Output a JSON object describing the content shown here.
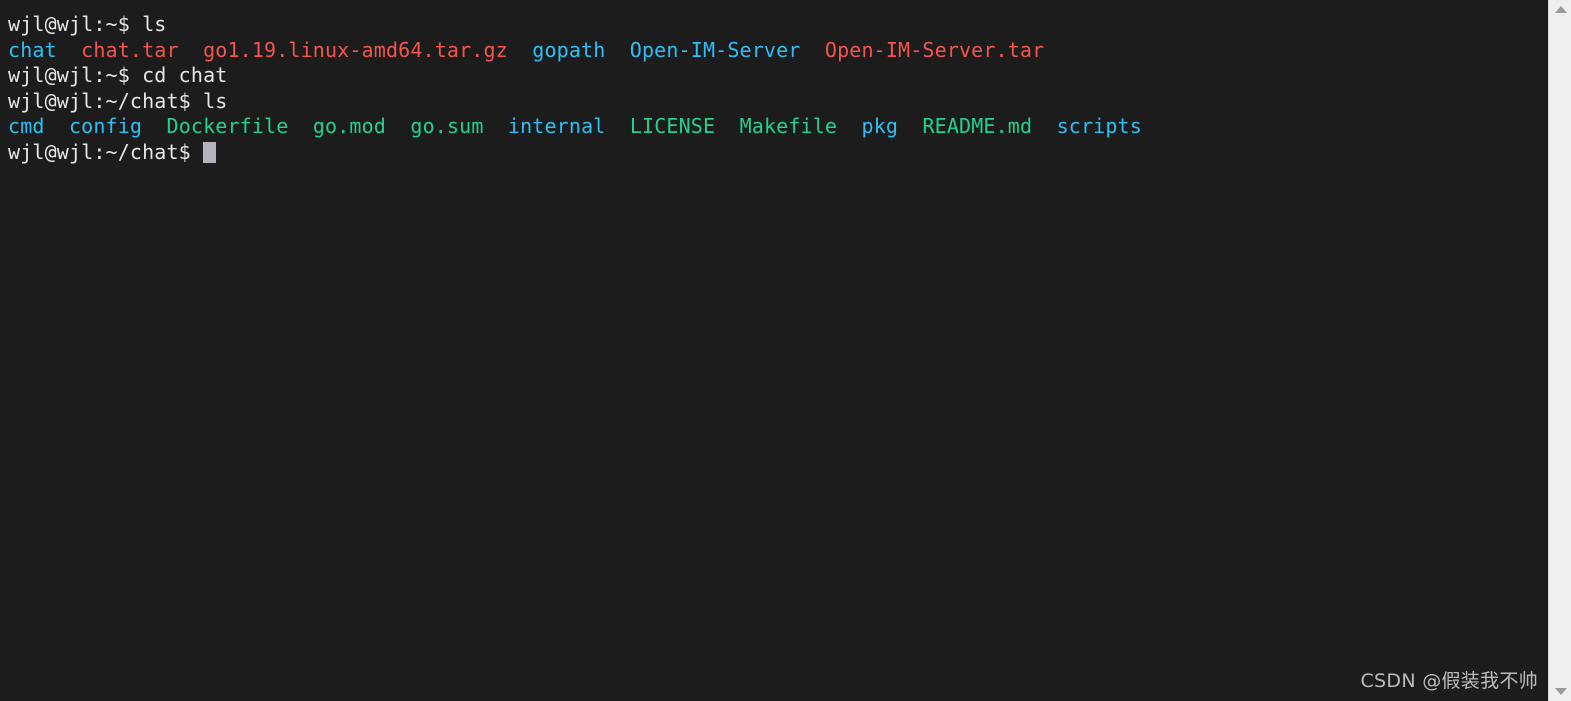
{
  "terminal": {
    "prompt_user_host_home": "wjl@wjl:~$ ",
    "prompt_user_host_chat": "wjl@wjl:~/chat$ ",
    "lines": [
      {
        "id": "line-cmd-ls-home",
        "segments": [
          {
            "text": "wjl@wjl:~$ ",
            "kind": "default"
          },
          {
            "text": "ls",
            "kind": "default"
          }
        ]
      },
      {
        "id": "line-output-ls-home",
        "segments": [
          {
            "text": "chat",
            "kind": "dir"
          },
          {
            "text": "  ",
            "kind": "default"
          },
          {
            "text": "chat.tar",
            "kind": "archive"
          },
          {
            "text": "  ",
            "kind": "default"
          },
          {
            "text": "go1.19.linux-amd64.tar.gz",
            "kind": "archive"
          },
          {
            "text": "  ",
            "kind": "default"
          },
          {
            "text": "gopath",
            "kind": "dir"
          },
          {
            "text": "  ",
            "kind": "default"
          },
          {
            "text": "Open-IM-Server",
            "kind": "dir"
          },
          {
            "text": "  ",
            "kind": "default"
          },
          {
            "text": "Open-IM-Server.tar",
            "kind": "archive"
          }
        ]
      },
      {
        "id": "line-cmd-cd-chat",
        "segments": [
          {
            "text": "wjl@wjl:~$ ",
            "kind": "default"
          },
          {
            "text": "cd chat",
            "kind": "default"
          }
        ]
      },
      {
        "id": "line-cmd-ls-chat",
        "segments": [
          {
            "text": "wjl@wjl:~/chat$ ",
            "kind": "default"
          },
          {
            "text": "ls",
            "kind": "default"
          }
        ]
      },
      {
        "id": "line-output-ls-chat",
        "segments": [
          {
            "text": "cmd",
            "kind": "dir"
          },
          {
            "text": "  ",
            "kind": "default"
          },
          {
            "text": "config",
            "kind": "dir"
          },
          {
            "text": "  ",
            "kind": "default"
          },
          {
            "text": "Dockerfile",
            "kind": "exec"
          },
          {
            "text": "  ",
            "kind": "default"
          },
          {
            "text": "go.mod",
            "kind": "exec"
          },
          {
            "text": "  ",
            "kind": "default"
          },
          {
            "text": "go.sum",
            "kind": "exec"
          },
          {
            "text": "  ",
            "kind": "default"
          },
          {
            "text": "internal",
            "kind": "dir"
          },
          {
            "text": "  ",
            "kind": "default"
          },
          {
            "text": "LICENSE",
            "kind": "exec"
          },
          {
            "text": "  ",
            "kind": "default"
          },
          {
            "text": "Makefile",
            "kind": "exec"
          },
          {
            "text": "  ",
            "kind": "default"
          },
          {
            "text": "pkg",
            "kind": "dir"
          },
          {
            "text": "  ",
            "kind": "default"
          },
          {
            "text": "README.md",
            "kind": "exec"
          },
          {
            "text": "  ",
            "kind": "default"
          },
          {
            "text": "scripts",
            "kind": "dir"
          }
        ]
      },
      {
        "id": "line-prompt-current",
        "segments": [
          {
            "text": "wjl@wjl:~/chat$ ",
            "kind": "default"
          }
        ],
        "cursor": true
      }
    ]
  },
  "scrollbar": {
    "up_arrow_icon": "triangle-up-icon",
    "down_arrow_icon": "triangle-down-icon"
  },
  "watermark": {
    "text": "CSDN @假装我不帅"
  },
  "colors": {
    "background": "#1c1c1c",
    "default_text": "#e6e6e6",
    "directory": "#2fbff5",
    "archive": "#f5544e",
    "executable": "#23d18b",
    "cursor": "#b3b3bf",
    "scrollbar_track": "#efefef",
    "scrollbar_arrow": "#9a9a9a",
    "watermark_text": "#c9c9c9"
  }
}
